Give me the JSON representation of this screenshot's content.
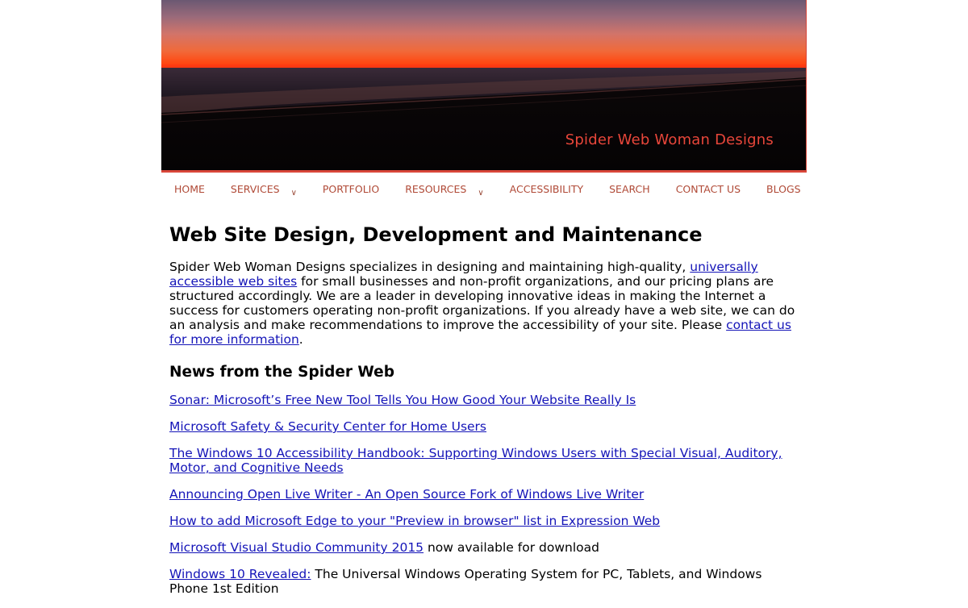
{
  "banner": {
    "site_name": "Spider Web Woman Designs",
    "image_description": "sunset-beach-photo"
  },
  "nav": {
    "items": [
      {
        "label": "HOME",
        "active": true,
        "has_dropdown": false
      },
      {
        "label": "SERVICES",
        "active": false,
        "has_dropdown": true
      },
      {
        "label": "PORTFOLIO",
        "active": false,
        "has_dropdown": false
      },
      {
        "label": "RESOURCES",
        "active": false,
        "has_dropdown": true
      },
      {
        "label": "ACCESSIBILITY",
        "active": false,
        "has_dropdown": false
      },
      {
        "label": "SEARCH",
        "active": false,
        "has_dropdown": false
      },
      {
        "label": "CONTACT US",
        "active": false,
        "has_dropdown": false
      },
      {
        "label": "BLOGS",
        "active": false,
        "has_dropdown": false
      }
    ],
    "chevron_icon": "chevron-down-icon"
  },
  "main": {
    "heading": "Web Site Design, Development and Maintenance",
    "intro": {
      "part1": "Spider Web Woman Designs specializes in designing and maintaining high-quality, ",
      "link1": "universally accessible web sites",
      "part2": " for small businesses and non-profit organizations, and our pricing plans are structured accordingly. We are a leader in developing innovative ideas in making the Internet a success for customers operating non-profit organizations. If you already have a web site, we can do an analysis and make recommendations to improve the accessibility of your site. Please ",
      "link2": "contact us for more information",
      "part3": "."
    },
    "news_heading": "News from the Spider Web",
    "news": [
      {
        "link": "Sonar: Microsoft’s Free New Tool Tells You How Good Your Website Really Is",
        "rest": ""
      },
      {
        "link": "Microsoft Safety & Security Center for Home Users",
        "rest": ""
      },
      {
        "link": "The Windows 10 Accessibility Handbook: Supporting Windows Users with Special Visual, Auditory, Motor, and Cognitive Needs",
        "rest": ""
      },
      {
        "link": "Announcing Open Live Writer - An Open Source Fork of Windows Live Writer",
        "rest": ""
      },
      {
        "link": "How to add Microsoft Edge to your \"Preview in browser\" list in Expression Web",
        "rest": ""
      },
      {
        "link": "Microsoft Visual Studio Community 2015",
        "rest": " now available for download"
      },
      {
        "link": "Windows 10 Revealed:",
        "rest": " The Universal Windows Operating System for PC, Tablets, and Windows Phone 1st Edition"
      }
    ]
  },
  "colors": {
    "accent": "#d9473a",
    "nav_text": "#b04a37",
    "link": "#1414b8",
    "banner_title": "#e8463a"
  }
}
